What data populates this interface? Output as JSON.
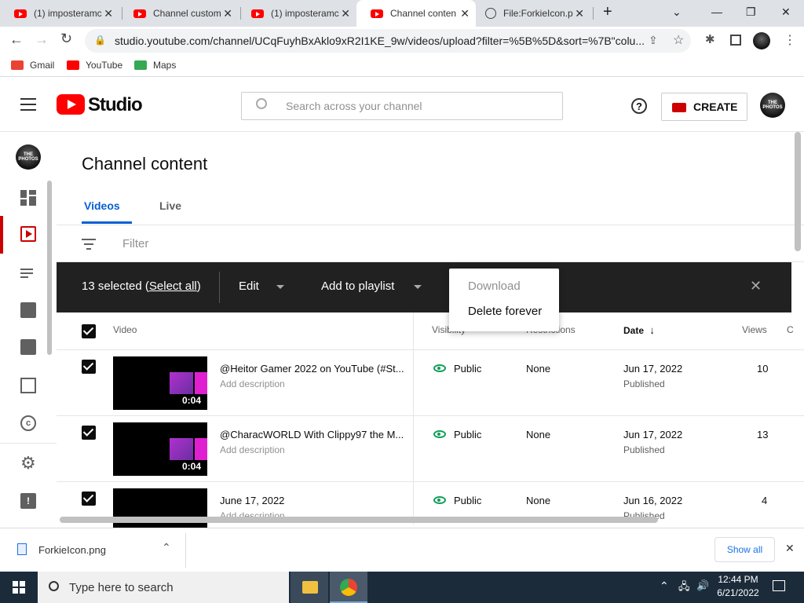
{
  "browser": {
    "tabs": [
      {
        "title": "(1) imposteramc",
        "icon": "youtube-icon"
      },
      {
        "title": "Channel custom",
        "icon": "youtube-icon"
      },
      {
        "title": "(1) imposteramc",
        "icon": "youtube-icon"
      },
      {
        "title": "Channel conten",
        "icon": "youtube-icon",
        "active": true
      },
      {
        "title": "File:ForkieIcon.p",
        "icon": "wiki-icon"
      }
    ],
    "new_tab": "+",
    "url": "studio.youtube.com/channel/UCqFuyhBxAklo9xR2I1KE_9w/videos/upload?filter=%5B%5D&sort=%7B\"colu...",
    "bookmarks": [
      {
        "label": "Gmail",
        "color": "#ea4335"
      },
      {
        "label": "YouTube",
        "color": "#ff0000"
      },
      {
        "label": "Maps",
        "color": "#34a853"
      }
    ]
  },
  "header": {
    "logo_text": "Studio",
    "search_placeholder": "Search across your channel",
    "help": "?",
    "create_label": "CREATE",
    "avatar_text": "THE PHOTOS"
  },
  "page": {
    "title": "Channel content",
    "tabs": [
      {
        "label": "Videos",
        "active": true
      },
      {
        "label": "Live",
        "active": false
      }
    ],
    "filter_placeholder": "Filter"
  },
  "action_bar": {
    "selected_prefix": "13 selected (",
    "select_all": "Select all",
    "selected_suffix": ")",
    "edit": "Edit",
    "add_to_playlist": "Add to playlist",
    "close": "✕"
  },
  "more_menu": {
    "items": [
      {
        "label": "Download",
        "disabled": true
      },
      {
        "label": "Delete forever",
        "disabled": false
      }
    ]
  },
  "columns": {
    "video": "Video",
    "visibility": "Visibility",
    "restrictions": "Restrictions",
    "date": "Date",
    "views": "Views",
    "comments": "C"
  },
  "rows": [
    {
      "title": "@Heitor Gamer 2022 on YouTube (#St...",
      "description": "Add description",
      "duration": "0:04",
      "visibility": "Public",
      "restrictions": "None",
      "date": "Jun 17, 2022",
      "status": "Published",
      "views": "10"
    },
    {
      "title": "@CharacWORLD With Clippy97 the M...",
      "description": "Add description",
      "duration": "0:04",
      "visibility": "Public",
      "restrictions": "None",
      "date": "Jun 17, 2022",
      "status": "Published",
      "views": "13"
    },
    {
      "title": "June 17, 2022",
      "description": "Add description",
      "duration": "",
      "visibility": "Public",
      "restrictions": "None",
      "date": "Jun 16, 2022",
      "status": "Published",
      "views": "4"
    }
  ],
  "download_bar": {
    "file": "ForkieIcon.png",
    "show_all": "Show all"
  },
  "taskbar": {
    "search_placeholder": "Type here to search",
    "time": "12:44 PM",
    "date": "6/21/2022"
  }
}
